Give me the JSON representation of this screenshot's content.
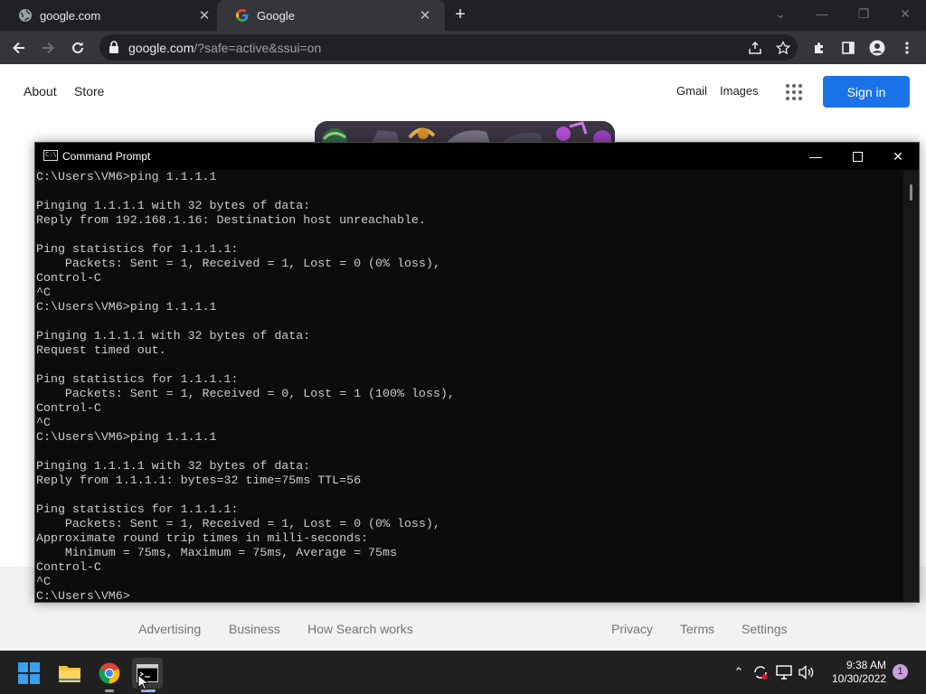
{
  "browser": {
    "tabs": [
      {
        "title": "google.com",
        "active": false
      },
      {
        "title": "Google",
        "active": true
      }
    ],
    "url_host": "google.com",
    "url_rest": "/?safe=active&ssui=on"
  },
  "google": {
    "nav_left": [
      "About",
      "Store"
    ],
    "nav_right": [
      "Gmail",
      "Images"
    ],
    "sign_in": "Sign in",
    "footer_left": [
      "Advertising",
      "Business",
      "How Search works"
    ],
    "footer_right": [
      "Privacy",
      "Terms",
      "Settings"
    ]
  },
  "cmd": {
    "title": "Command Prompt",
    "lines": [
      "C:\\Users\\VM6>ping 1.1.1.1",
      "",
      "Pinging 1.1.1.1 with 32 bytes of data:",
      "Reply from 192.168.1.16: Destination host unreachable.",
      "",
      "Ping statistics for 1.1.1.1:",
      "    Packets: Sent = 1, Received = 1, Lost = 0 (0% loss),",
      "Control-C",
      "^C",
      "C:\\Users\\VM6>ping 1.1.1.1",
      "",
      "Pinging 1.1.1.1 with 32 bytes of data:",
      "Request timed out.",
      "",
      "Ping statistics for 1.1.1.1:",
      "    Packets: Sent = 1, Received = 0, Lost = 1 (100% loss),",
      "Control-C",
      "^C",
      "C:\\Users\\VM6>ping 1.1.1.1",
      "",
      "Pinging 1.1.1.1 with 32 bytes of data:",
      "Reply from 1.1.1.1: bytes=32 time=75ms TTL=56",
      "",
      "Ping statistics for 1.1.1.1:",
      "    Packets: Sent = 1, Received = 1, Lost = 0 (0% loss),",
      "Approximate round trip times in milli-seconds:",
      "    Minimum = 75ms, Maximum = 75ms, Average = 75ms",
      "Control-C",
      "^C",
      "C:\\Users\\VM6>"
    ]
  },
  "taskbar": {
    "time": "9:38 AM",
    "date": "10/30/2022",
    "notification_count": "1",
    "apps": [
      "start-icon",
      "file-explorer-icon",
      "chrome-icon",
      "terminal-icon"
    ]
  },
  "colors": {
    "chrome_dark": "#202124",
    "chrome_toolbar": "#35363a",
    "google_blue": "#1a73e8",
    "console_bg": "#0c0c0c",
    "console_text": "#cccccc"
  }
}
